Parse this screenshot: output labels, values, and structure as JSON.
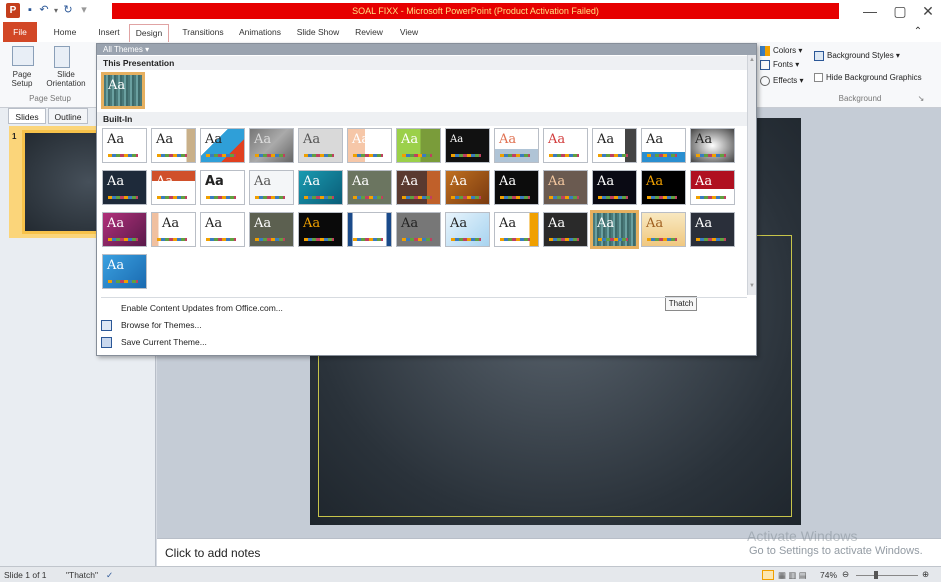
{
  "window": {
    "title": "SOAL FIXX - Microsoft PowerPoint (Product Activation Failed)",
    "app_icon": "P",
    "minimize": "—",
    "restore": "▢",
    "close": "✕"
  },
  "tabs": {
    "file": "File",
    "home": "Home",
    "insert": "Insert",
    "design": "Design",
    "transitions": "Transitions",
    "animations": "Animations",
    "slideshow": "Slide Show",
    "review": "Review",
    "view": "View"
  },
  "ribbon": {
    "page_setup": "Page Setup",
    "slide_orientation": "Slide Orientation",
    "group_page_setup": "Page Setup",
    "colors": "Colors",
    "fonts": "Fonts",
    "effects": "Effects",
    "background_styles": "Background Styles",
    "hide_background_graphics": "Hide Background Graphics",
    "group_background": "Background"
  },
  "left_pane": {
    "tab_slides": "Slides",
    "tab_outline": "Outline",
    "slide_number": "1"
  },
  "themes_gallery": {
    "header": "All Themes ▾",
    "section_this_presentation": "This Presentation",
    "section_built_in": "Built-In",
    "tooltip": "Thatch",
    "thumb_label": "Aa",
    "menu": {
      "enable_updates": "Enable Content Updates from Office.com...",
      "browse": "Browse for Themes...",
      "save": "Save Current Theme..."
    }
  },
  "notes": {
    "placeholder": "Click to add notes"
  },
  "watermark": {
    "line1": "Activate Windows",
    "line2": "Go to Settings to activate Windows."
  },
  "status_bar": {
    "slide_info": "Slide 1 of 1",
    "theme_name": "\"Thatch\"",
    "zoom": "74%"
  },
  "colors": {
    "title_red": "#e60000",
    "file_tab": "#d24726",
    "selection": "#f7c24a"
  }
}
